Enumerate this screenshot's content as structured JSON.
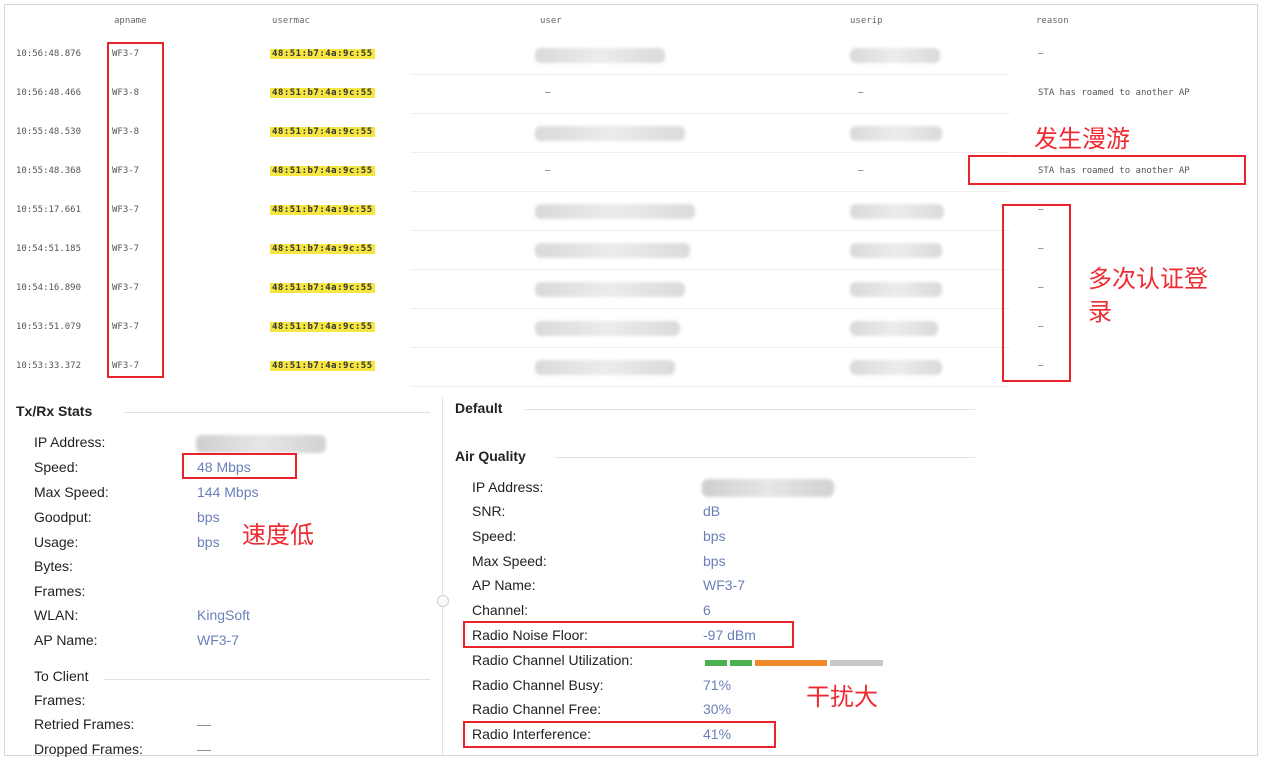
{
  "columns": {
    "apname": "apname",
    "usermac": "usermac",
    "user": "user",
    "userip": "userip",
    "reason": "reason"
  },
  "log_rows": [
    {
      "time": "10:56:48.876",
      "ap": "WF3-7",
      "mac": "48:51:b7:4a:9c:55",
      "user": "",
      "ip": "",
      "reason": "—"
    },
    {
      "time": "10:56:48.466",
      "ap": "WF3-8",
      "mac": "48:51:b7:4a:9c:55",
      "user": "—",
      "ip": "—",
      "reason": "STA has roamed to another AP"
    },
    {
      "time": "10:55:48.530",
      "ap": "WF3-8",
      "mac": "48:51:b7:4a:9c:55",
      "user": "",
      "ip": "",
      "reason": ""
    },
    {
      "time": "10:55:48.368",
      "ap": "WF3-7",
      "mac": "48:51:b7:4a:9c:55",
      "user": "—",
      "ip": "—",
      "reason": "STA has roamed to another AP"
    },
    {
      "time": "10:55:17.661",
      "ap": "WF3-7",
      "mac": "48:51:b7:4a:9c:55",
      "user": "",
      "ip": "",
      "reason": "—"
    },
    {
      "time": "10:54:51.185",
      "ap": "WF3-7",
      "mac": "48:51:b7:4a:9c:55",
      "user": "",
      "ip": "",
      "reason": "—"
    },
    {
      "time": "10:54:16.890",
      "ap": "WF3-7",
      "mac": "48:51:b7:4a:9c:55",
      "user": "",
      "ip": "",
      "reason": "—"
    },
    {
      "time": "10:53:51.079",
      "ap": "WF3-7",
      "mac": "48:51:b7:4a:9c:55",
      "user": "",
      "ip": "",
      "reason": "—"
    },
    {
      "time": "10:53:33.372",
      "ap": "WF3-7",
      "mac": "48:51:b7:4a:9c:55",
      "user": "",
      "ip": "",
      "reason": "—"
    }
  ],
  "txrx": {
    "title": "Tx/Rx Stats",
    "rows": [
      {
        "label": "IP Address:",
        "value": ""
      },
      {
        "label": "Speed:",
        "value": "48 Mbps"
      },
      {
        "label": "Max Speed:",
        "value": "144 Mbps"
      },
      {
        "label": "Goodput:",
        "value": "bps"
      },
      {
        "label": "Usage:",
        "value": "bps"
      },
      {
        "label": "Bytes:",
        "value": ""
      },
      {
        "label": "Frames:",
        "value": ""
      },
      {
        "label": "WLAN:",
        "value": "KingSoft"
      },
      {
        "label": "AP Name:",
        "value": "WF3-7"
      }
    ],
    "to_client_title": "To Client",
    "to_client": [
      {
        "label": "Frames:",
        "value": ""
      },
      {
        "label": "Retried Frames:",
        "value": "—"
      },
      {
        "label": "Dropped Frames:",
        "value": "—"
      }
    ]
  },
  "default_title": "Default",
  "air": {
    "title": "Air Quality",
    "rows": [
      {
        "label": "IP Address:",
        "value": ""
      },
      {
        "label": "SNR:",
        "value": "dB"
      },
      {
        "label": "Speed:",
        "value": "bps"
      },
      {
        "label": "Max Speed:",
        "value": "bps"
      },
      {
        "label": "AP Name:",
        "value": "WF3-7"
      },
      {
        "label": "Channel:",
        "value": "6"
      },
      {
        "label": "Radio Noise Floor:",
        "value": "-97 dBm"
      },
      {
        "label": "Radio Channel Utilization:",
        "value": ""
      },
      {
        "label": "Radio Channel Busy:",
        "value": "71%"
      },
      {
        "label": "Radio Channel Free:",
        "value": "30%"
      },
      {
        "label": "Radio Interference:",
        "value": "41%"
      }
    ],
    "utilization_segments": [
      {
        "color": "#4caf50",
        "fraction": 0.13
      },
      {
        "color": "#4caf50",
        "fraction": 0.13
      },
      {
        "color": "#f0892a",
        "fraction": 0.39
      },
      {
        "color": "#c8c8c8",
        "fraction": 0.29
      }
    ]
  },
  "notes": {
    "roaming": "发生漫游",
    "multi_auth": "多次认证登录",
    "multi_auth_line2": "录",
    "low_speed": "速度低",
    "interference": "干扰大"
  },
  "colors": {
    "annotation_red": "#e8232c",
    "mac_highlight": "#f5e642",
    "value_blue": "#6a7fb8"
  }
}
